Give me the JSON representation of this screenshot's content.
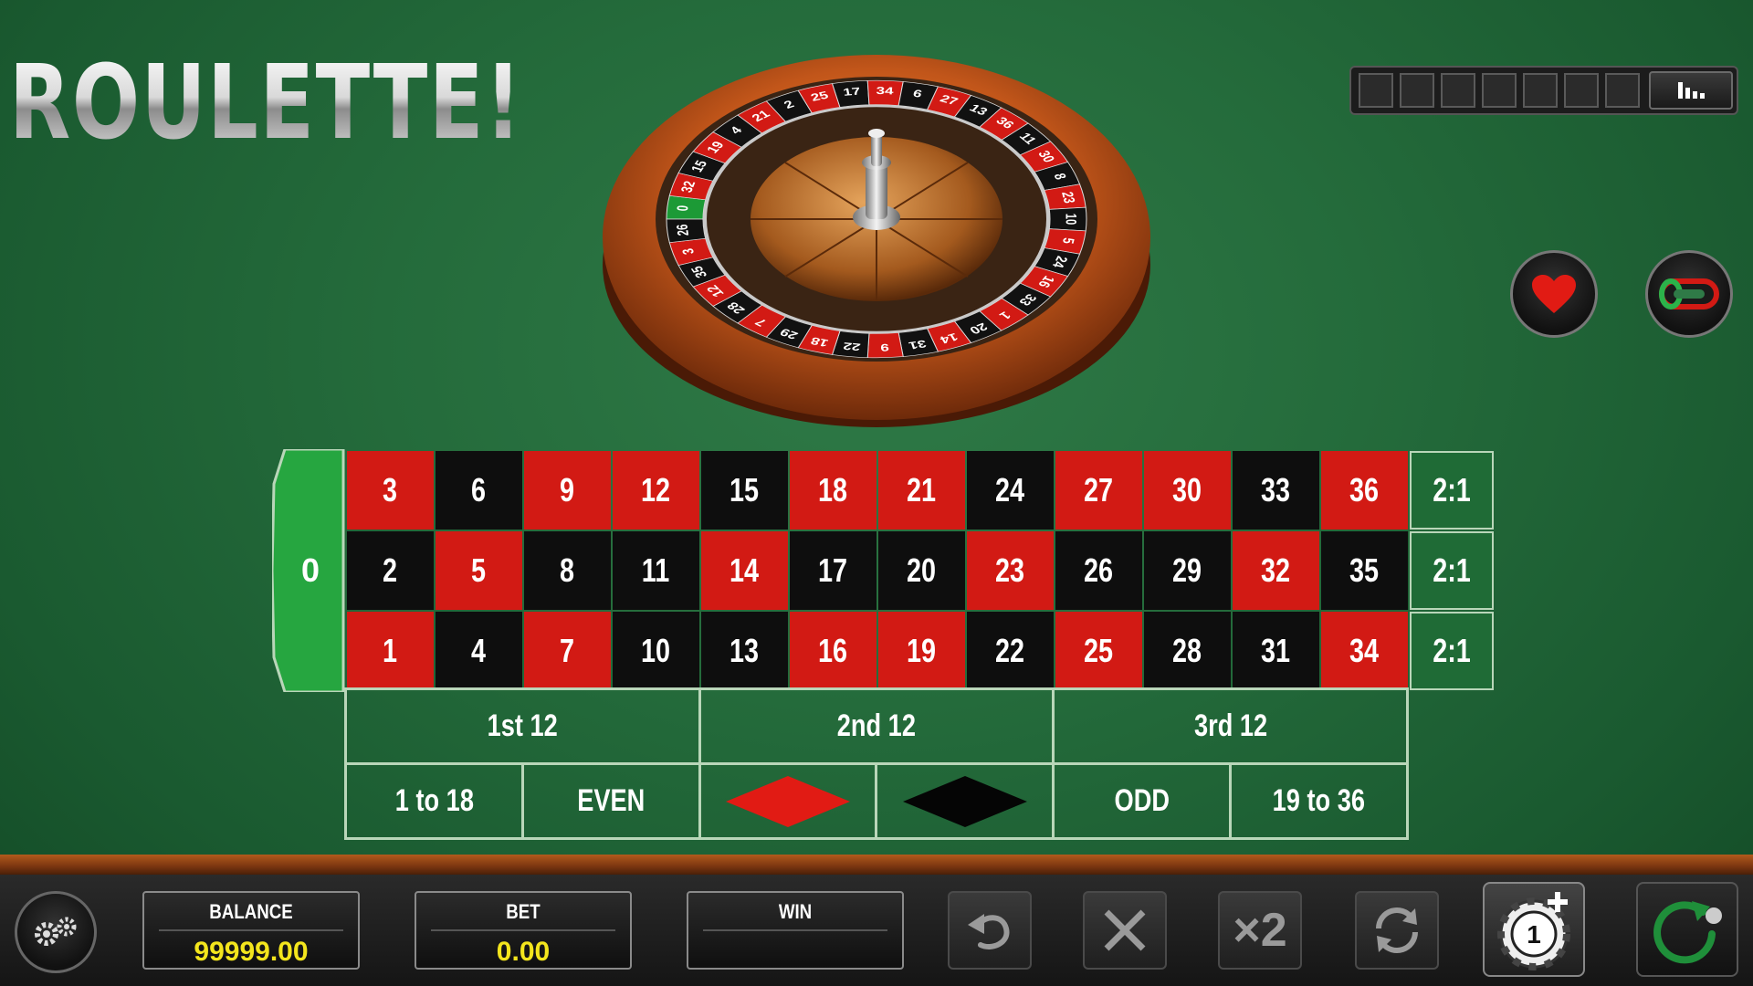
{
  "title": "ROULETTE!",
  "history": {
    "slots": 7,
    "stats_icon": "bar-chart-icon"
  },
  "buttons": {
    "favorites_icon": "heart-icon",
    "racetrack_icon": "racetrack-icon"
  },
  "wheel_numbers": [
    "0",
    "32",
    "15",
    "19",
    "4",
    "21",
    "2",
    "25",
    "17",
    "34",
    "6",
    "27",
    "13",
    "36",
    "11",
    "30",
    "8",
    "23",
    "10",
    "5",
    "24",
    "16",
    "33",
    "1",
    "20",
    "14",
    "31",
    "9",
    "22",
    "18",
    "29",
    "7",
    "28",
    "12",
    "35",
    "3",
    "26"
  ],
  "board": {
    "zero": "0",
    "rows": [
      [
        {
          "n": "3",
          "c": "red"
        },
        {
          "n": "6",
          "c": "black"
        },
        {
          "n": "9",
          "c": "red"
        },
        {
          "n": "12",
          "c": "red"
        },
        {
          "n": "15",
          "c": "black"
        },
        {
          "n": "18",
          "c": "red"
        },
        {
          "n": "21",
          "c": "red"
        },
        {
          "n": "24",
          "c": "black"
        },
        {
          "n": "27",
          "c": "red"
        },
        {
          "n": "30",
          "c": "red"
        },
        {
          "n": "33",
          "c": "black"
        },
        {
          "n": "36",
          "c": "red"
        }
      ],
      [
        {
          "n": "2",
          "c": "black"
        },
        {
          "n": "5",
          "c": "red"
        },
        {
          "n": "8",
          "c": "black"
        },
        {
          "n": "11",
          "c": "black"
        },
        {
          "n": "14",
          "c": "red"
        },
        {
          "n": "17",
          "c": "black"
        },
        {
          "n": "20",
          "c": "black"
        },
        {
          "n": "23",
          "c": "red"
        },
        {
          "n": "26",
          "c": "black"
        },
        {
          "n": "29",
          "c": "black"
        },
        {
          "n": "32",
          "c": "red"
        },
        {
          "n": "35",
          "c": "black"
        }
      ],
      [
        {
          "n": "1",
          "c": "red"
        },
        {
          "n": "4",
          "c": "black"
        },
        {
          "n": "7",
          "c": "red"
        },
        {
          "n": "10",
          "c": "black"
        },
        {
          "n": "13",
          "c": "black"
        },
        {
          "n": "16",
          "c": "red"
        },
        {
          "n": "19",
          "c": "red"
        },
        {
          "n": "22",
          "c": "black"
        },
        {
          "n": "25",
          "c": "red"
        },
        {
          "n": "28",
          "c": "black"
        },
        {
          "n": "31",
          "c": "black"
        },
        {
          "n": "34",
          "c": "red"
        }
      ]
    ],
    "column_bets": [
      "2:1",
      "2:1",
      "2:1"
    ],
    "dozens": [
      "1st 12",
      "2nd 12",
      "3rd 12"
    ],
    "outside": {
      "low": "1 to 18",
      "even": "EVEN",
      "red": "red-diamond",
      "black": "black-diamond",
      "odd": "ODD",
      "high": "19 to 36"
    }
  },
  "bottom": {
    "balance_label": "BALANCE",
    "balance_value": "99999.00",
    "bet_label": "BET",
    "bet_value": "0.00",
    "win_label": "WIN",
    "win_value": "",
    "undo_icon": "undo-icon",
    "clear_icon": "clear-icon",
    "double_label": "×2",
    "rebet_icon": "rebet-icon",
    "chip_value": "1",
    "spin_icon": "spin-icon",
    "settings_icon": "gear-icon"
  }
}
